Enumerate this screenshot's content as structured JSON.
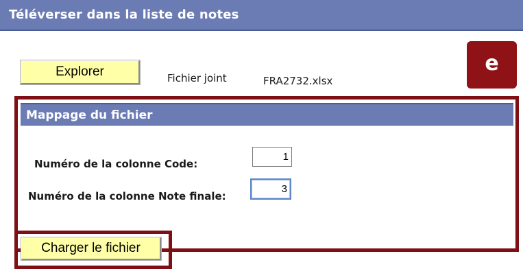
{
  "header": {
    "title": "Téléverser dans la liste de notes"
  },
  "upload": {
    "explore_label": "Explorer",
    "attached_label": "Fichier joint",
    "attached_value": "FRA2732.xlsx"
  },
  "badge": {
    "text": "e"
  },
  "mapping": {
    "title": "Mappage du fichier",
    "code_label": "Numéro de la colonne Code:",
    "code_value": "1",
    "note_label": "Numéro de la colonne Note finale:",
    "note_value": "3"
  },
  "actions": {
    "load_label": "Charger le fichier"
  },
  "colors": {
    "header_bg": "#6b7bb3",
    "button_bg": "#ffffa8",
    "highlight": "#7d0f15",
    "badge_bg": "#8f1216"
  }
}
